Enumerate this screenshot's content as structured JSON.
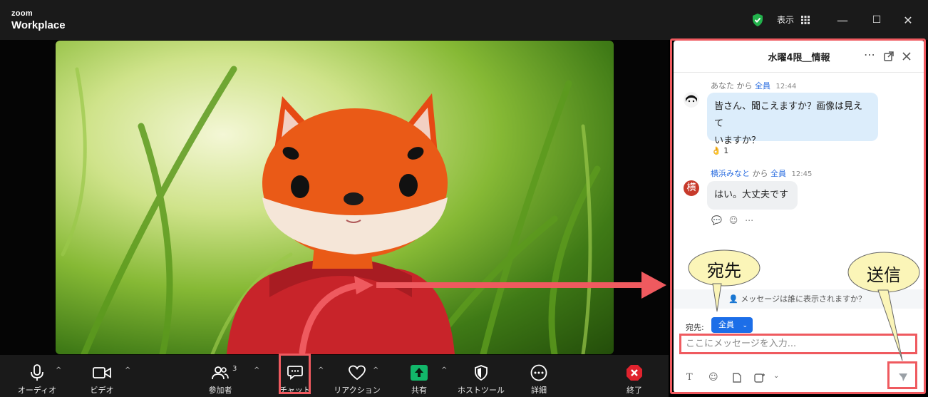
{
  "app": {
    "logo_small": "zoom",
    "logo_large": "Workplace"
  },
  "titlebar": {
    "view_label": "表示",
    "minimize": "—",
    "maximize": "☐",
    "close": "✕"
  },
  "toolbar": {
    "audio": "オーディオ",
    "video": "ビデオ",
    "participants": "参加者",
    "participants_count": "3",
    "chat": "チャット",
    "reactions": "リアクション",
    "share": "共有",
    "host_tools": "ホストツール",
    "more": "詳細",
    "end": "終了"
  },
  "chat": {
    "title": "水曜4限＿情報",
    "messages": [
      {
        "sender": "あなた",
        "from": "から",
        "to": "全員",
        "time": "12:44",
        "line1": "皆さん、聞こえますか？画像は見えて",
        "line2": "いますか？",
        "reaction_emoji": "👌",
        "reaction_count": "1"
      },
      {
        "sender": "横浜みなと",
        "from": "から",
        "to": "全員",
        "time": "12:45",
        "avatar_char": "横",
        "text": "はい。大丈夫です"
      }
    ],
    "privacy_prompt": "メッセージは誰に表示されますか？",
    "to_label": "宛先:",
    "to_value": "全員",
    "input_placeholder": "ここにメッセージを入力..."
  },
  "annotations": {
    "recipient_callout": "宛先",
    "send_callout": "送信"
  },
  "colors": {
    "accent_red": "#ef5a5f",
    "accent_blue": "#1c6ee8",
    "callout_fill": "#fbf5b8"
  }
}
